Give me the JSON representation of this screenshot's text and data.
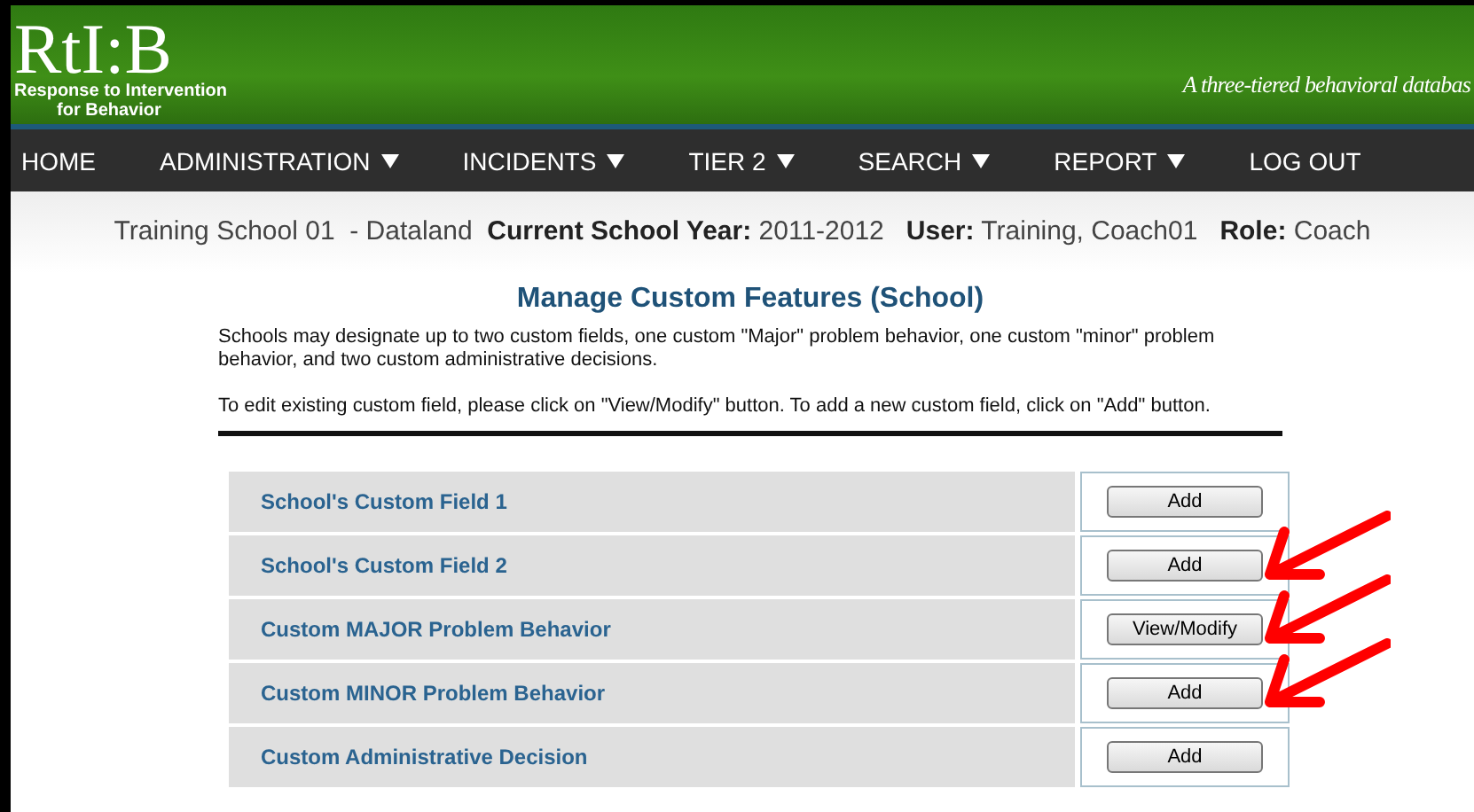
{
  "header": {
    "logo": "RtI:B",
    "logo_subtitle_1": "Response to Intervention",
    "logo_subtitle_2": "for Behavior",
    "tagline": "A three-tiered behavioral databas"
  },
  "nav": [
    {
      "label": "HOME",
      "caret": false
    },
    {
      "label": "ADMINISTRATION",
      "caret": true
    },
    {
      "label": "INCIDENTS",
      "caret": true
    },
    {
      "label": "TIER 2",
      "caret": true
    },
    {
      "label": "SEARCH",
      "caret": true
    },
    {
      "label": "REPORT",
      "caret": true
    },
    {
      "label": "LOG OUT",
      "caret": false
    }
  ],
  "info_line": "Training School 01  - Dataland  **Current School Year:** 2011-2012   **User:** Training, Coach01   **Role:** Coach",
  "title": "Manage Custom Features (School)",
  "description": "Schools may designate up to two custom fields, one custom \"Major\" problem behavior, one custom \"minor\" problem behavior, and two custom administrative decisions.",
  "instruction": "To edit existing custom field, please click on \"View/Modify\" button. To add a new custom field, click on \"Add\" button.",
  "rows": [
    {
      "label": "School's Custom Field 1",
      "button": "Add",
      "annotated": false
    },
    {
      "label": "School's Custom Field 2",
      "button": "Add",
      "annotated": true
    },
    {
      "label": "Custom MAJOR Problem Behavior",
      "button": "View/Modify",
      "annotated": true
    },
    {
      "label": "Custom MINOR Problem Behavior",
      "button": "Add",
      "annotated": true
    },
    {
      "label": "Custom Administrative Decision",
      "button": "Add",
      "annotated": false
    }
  ]
}
